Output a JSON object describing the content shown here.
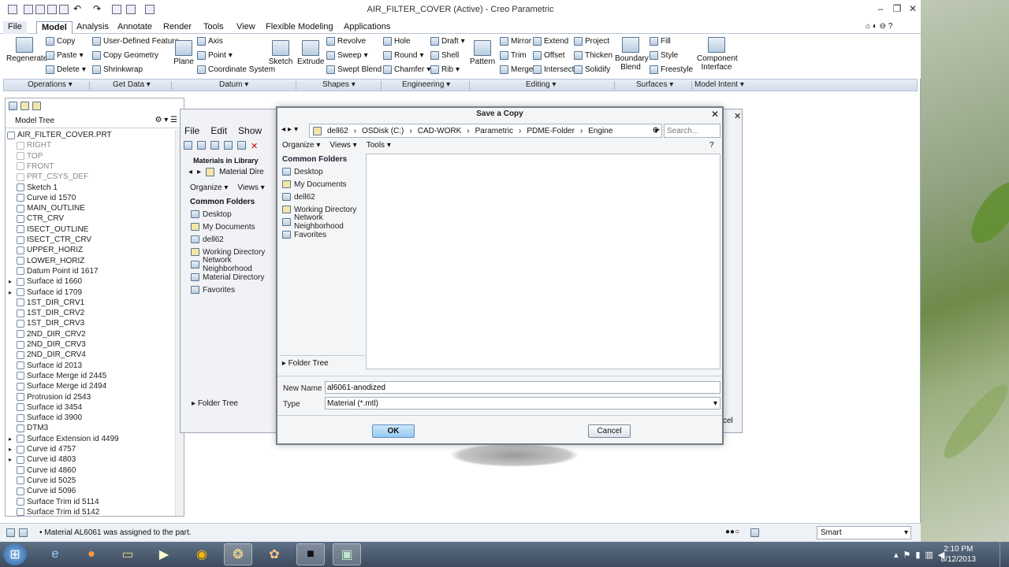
{
  "app": {
    "title": "AIR_FILTER_COVER (Active) - Creo Parametric",
    "menus": [
      "File",
      "Model",
      "Analysis",
      "Annotate",
      "Render",
      "Tools",
      "View",
      "Flexible Modeling",
      "Applications"
    ],
    "active_menu": "Model"
  },
  "ribbon": {
    "regenerate": "Regenerate",
    "copy": "Copy",
    "paste": "Paste",
    "delete": "Delete",
    "user_defined_feature": "User-Defined Feature",
    "copy_geometry": "Copy Geometry",
    "shrinkwrap": "Shrinkwrap",
    "plane": "Plane",
    "axis": "Axis",
    "point": "Point",
    "coordinate_system": "Coordinate System",
    "sketch": "Sketch",
    "extrude": "Extrude",
    "revolve": "Revolve",
    "sweep": "Sweep",
    "swept_blend": "Swept Blend",
    "hole": "Hole",
    "round": "Round",
    "chamfer": "Chamfer",
    "draft": "Draft",
    "shell": "Shell",
    "rib": "Rib",
    "pattern": "Pattern",
    "mirror": "Mirror",
    "trim": "Trim",
    "merge": "Merge",
    "extend": "Extend",
    "offset": "Offset",
    "intersect": "Intersect",
    "project": "Project",
    "thicken": "Thicken",
    "solidify": "Solidify",
    "boundary_blend": "Boundary Blend",
    "fill": "Fill",
    "style": "Style",
    "freestyle": "Freestyle",
    "component_interface": "Component Interface"
  },
  "groups": [
    "Operations",
    "Get Data",
    "Datum",
    "Shapes",
    "Engineering",
    "Editing",
    "Surfaces",
    "Model Intent"
  ],
  "tree": {
    "header": "Model Tree",
    "items": [
      {
        "label": "AIR_FILTER_COVER.PRT",
        "indent": 0,
        "gray": false
      },
      {
        "label": "RIGHT",
        "indent": 1,
        "gray": true
      },
      {
        "label": "TOP",
        "indent": 1,
        "gray": true
      },
      {
        "label": "FRONT",
        "indent": 1,
        "gray": true
      },
      {
        "label": "PRT_CSYS_DEF",
        "indent": 1,
        "gray": true
      },
      {
        "label": "Sketch 1",
        "indent": 1,
        "gray": false
      },
      {
        "label": "Curve id 1570",
        "indent": 1,
        "gray": false
      },
      {
        "label": "MAIN_OUTLINE",
        "indent": 1,
        "gray": false
      },
      {
        "label": "CTR_CRV",
        "indent": 1,
        "gray": false
      },
      {
        "label": "ISECT_OUTLINE",
        "indent": 1,
        "gray": false
      },
      {
        "label": "ISECT_CTR_CRV",
        "indent": 1,
        "gray": false
      },
      {
        "label": "UPPER_HORIZ",
        "indent": 1,
        "gray": false
      },
      {
        "label": "LOWER_HORIZ",
        "indent": 1,
        "gray": false
      },
      {
        "label": "Datum Point id 1617",
        "indent": 1,
        "gray": false
      },
      {
        "label": "Surface id 1660",
        "indent": 1,
        "gray": false
      },
      {
        "label": "Surface id 1709",
        "indent": 1,
        "gray": false
      },
      {
        "label": "1ST_DIR_CRV1",
        "indent": 1,
        "gray": false
      },
      {
        "label": "1ST_DIR_CRV2",
        "indent": 1,
        "gray": false
      },
      {
        "label": "1ST_DIR_CRV3",
        "indent": 1,
        "gray": false
      },
      {
        "label": "2ND_DIR_CRV2",
        "indent": 1,
        "gray": false
      },
      {
        "label": "2ND_DIR_CRV3",
        "indent": 1,
        "gray": false
      },
      {
        "label": "2ND_DIR_CRV4",
        "indent": 1,
        "gray": false
      },
      {
        "label": "Surface id 2013",
        "indent": 1,
        "gray": false
      },
      {
        "label": "Surface Merge id 2445",
        "indent": 1,
        "gray": false
      },
      {
        "label": "Surface Merge id 2494",
        "indent": 1,
        "gray": false
      },
      {
        "label": "Protrusion id 2543",
        "indent": 1,
        "gray": false
      },
      {
        "label": "Surface id 3454",
        "indent": 1,
        "gray": false
      },
      {
        "label": "Surface id 3900",
        "indent": 1,
        "gray": false
      },
      {
        "label": "DTM3",
        "indent": 1,
        "gray": false
      },
      {
        "label": "Surface Extension id 4499",
        "indent": 1,
        "gray": false
      },
      {
        "label": "Curve id 4757",
        "indent": 1,
        "gray": false
      },
      {
        "label": "Curve id 4803",
        "indent": 1,
        "gray": false
      },
      {
        "label": "Curve id 4860",
        "indent": 1,
        "gray": false
      },
      {
        "label": "Curve id 5025",
        "indent": 1,
        "gray": false
      },
      {
        "label": "Curve id 5096",
        "indent": 1,
        "gray": false
      },
      {
        "label": "Surface Trim id 5114",
        "indent": 1,
        "gray": false
      },
      {
        "label": "Surface Trim id 5142",
        "indent": 1,
        "gray": false
      }
    ]
  },
  "status": {
    "message": "Material AL6061 was assigned to the part.",
    "filter": "Smart"
  },
  "behind": {
    "menus": [
      "File",
      "Edit",
      "Show"
    ],
    "materials_label": "Materials in Library",
    "path": "Material Dire",
    "organize": "Organize",
    "views": "Views",
    "common_folders": "Common Folders",
    "folders": [
      "Desktop",
      "My Documents",
      "dell62",
      "Working Directory",
      "Network Neighborhood",
      "Material Directory",
      "Favorites"
    ],
    "folder_tree": "Folder Tree",
    "cancel_fragment": "cel"
  },
  "dialog": {
    "title": "Save a Copy",
    "path": [
      "dell62",
      "OSDisk (C:)",
      "CAD-WORK",
      "Parametric",
      "PDME-Folder",
      "Engine"
    ],
    "search_placeholder": "Search...",
    "organize": "Organize",
    "views": "Views",
    "tools": "Tools",
    "common_folders": "Common Folders",
    "folders": [
      "Desktop",
      "My Documents",
      "dell62",
      "Working Directory",
      "Network Neighborhood",
      "Favorites"
    ],
    "folder_tree": "Folder Tree",
    "new_name_label": "New Name",
    "new_name_value": "al6061-anodized",
    "type_label": "Type",
    "type_value": "Material (*.mtl)",
    "ok": "OK",
    "cancel": "Cancel"
  },
  "taskbar": {
    "time": "2:10 PM",
    "date": "8/12/2013"
  }
}
